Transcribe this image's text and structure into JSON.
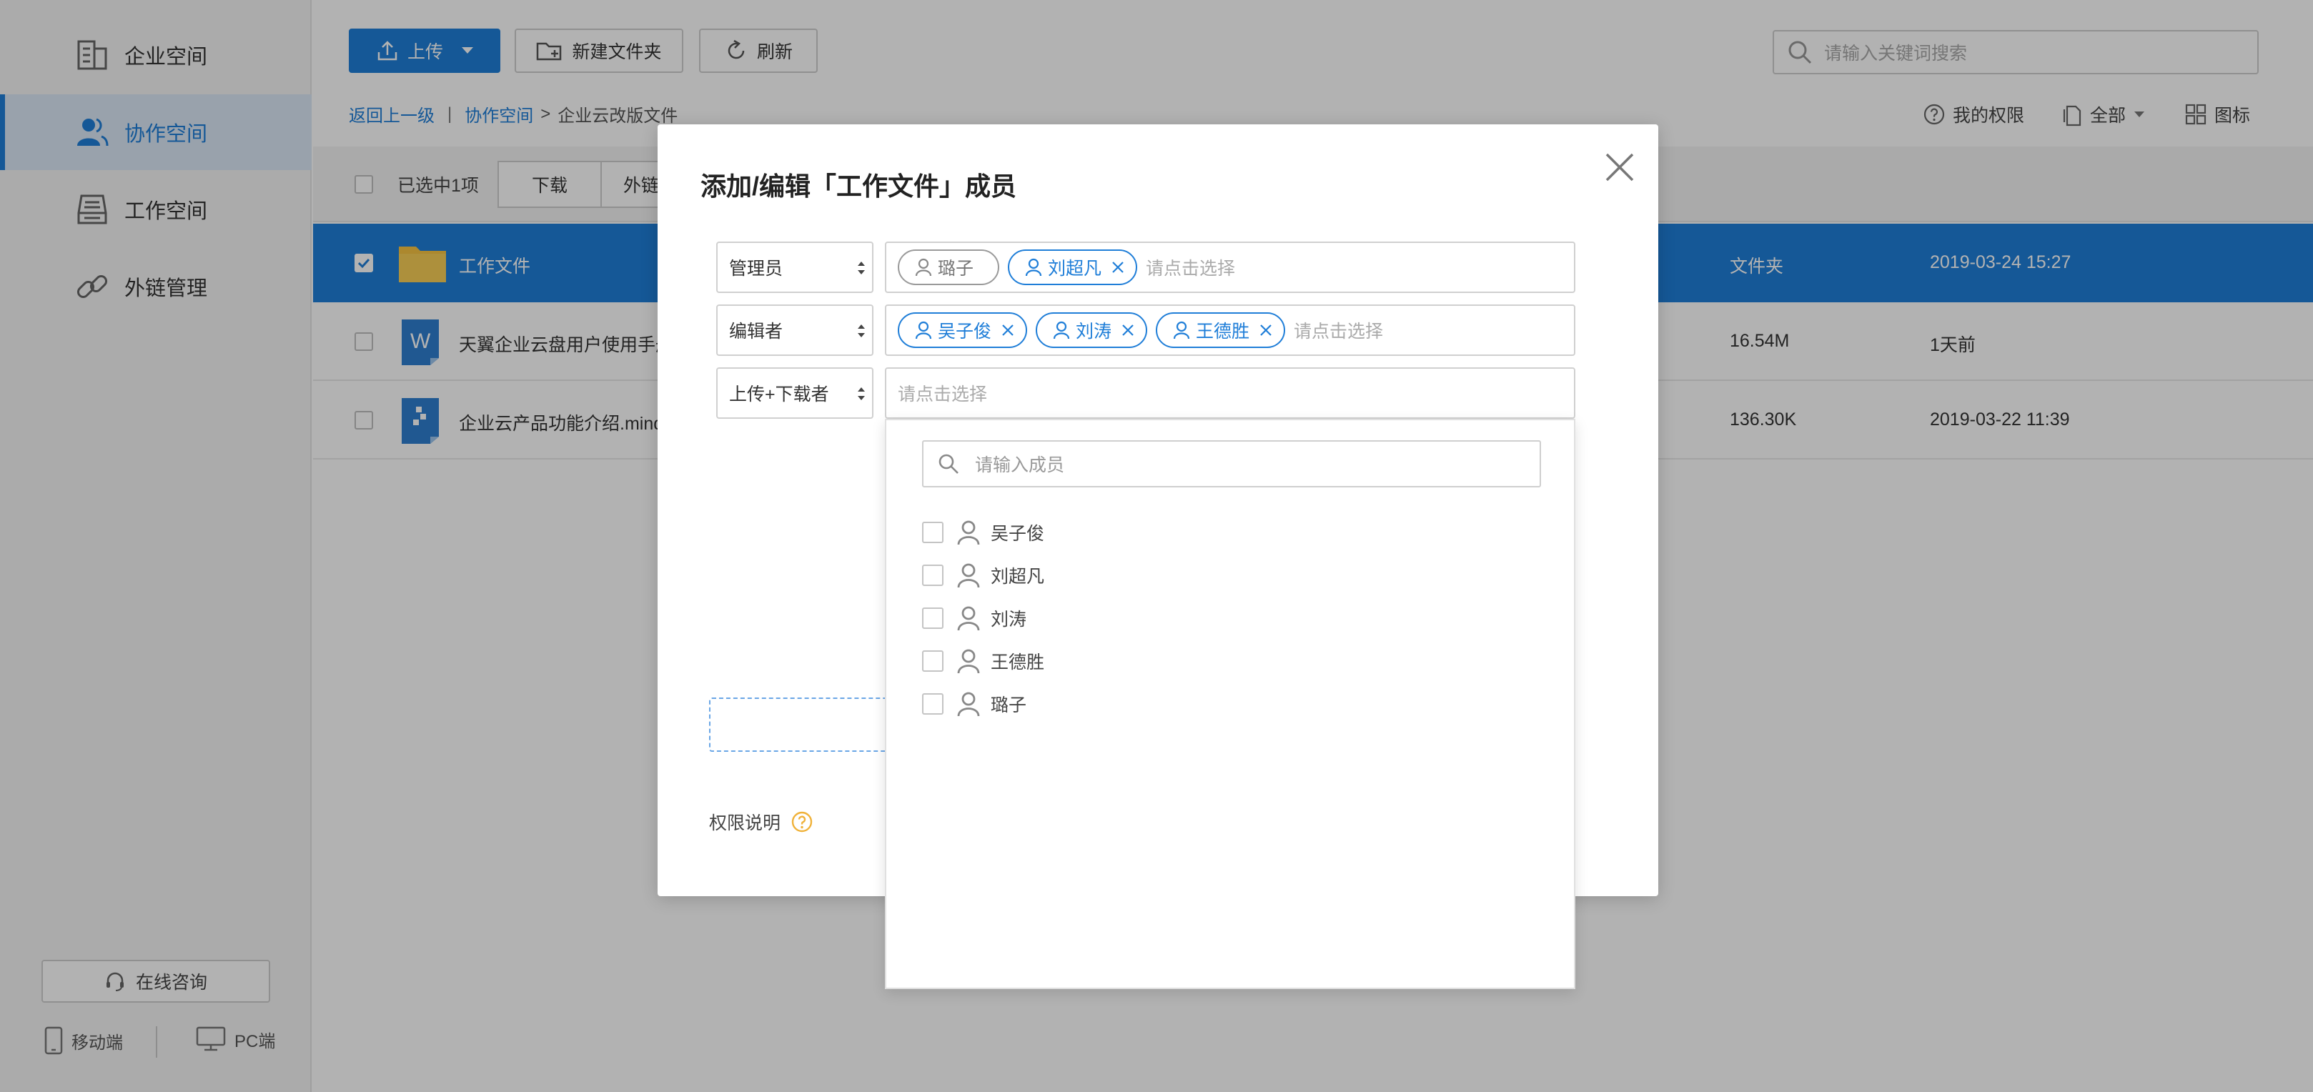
{
  "sidebar": {
    "items": [
      {
        "label": "企业空间",
        "icon": "building-icon"
      },
      {
        "label": "协作空间",
        "icon": "team-icon",
        "active": true
      },
      {
        "label": "工作空间",
        "icon": "inbox-icon"
      },
      {
        "label": "外链管理",
        "icon": "link-icon"
      }
    ],
    "consult_label": "在线咨询",
    "mobile_label": "移动端",
    "pc_label": "PC端"
  },
  "toolbar": {
    "upload_label": "上传",
    "new_folder_label": "新建文件夹",
    "refresh_label": "刷新",
    "search_placeholder": "请输入关键词搜索"
  },
  "breadcrumb": {
    "back": "返回上一级",
    "separator": "|",
    "parent": "协作空间",
    "arrow": ">",
    "current": "企业云改版文件"
  },
  "view_tools": {
    "permission": "我的权限",
    "filter": "全部",
    "view_mode": "图标"
  },
  "action_bar": {
    "selected_text": "已选中1项",
    "download": "下载",
    "share_link": "外链"
  },
  "files": [
    {
      "name": "工作文件",
      "type": "文件夹",
      "date": "2019-03-24 15:27",
      "selected": true,
      "icon": "folder-icon"
    },
    {
      "name": "天翼企业云盘用户使用手册",
      "type": "16.54M",
      "date": "1天前",
      "selected": false,
      "icon": "word-doc-icon",
      "icon_letter": "W"
    },
    {
      "name": "企业云产品功能介绍.mindr",
      "type": "136.30K",
      "date": "2019-03-22 11:39",
      "selected": false,
      "icon": "mindmap-file-icon"
    }
  ],
  "modal": {
    "title": "添加/编辑「工作文件」成员",
    "placeholder": "请点击选择",
    "roles": [
      {
        "role": "管理员",
        "members": [
          {
            "name": "璐子",
            "removable": false
          },
          {
            "name": "刘超凡",
            "removable": true
          }
        ]
      },
      {
        "role": "编辑者",
        "members": [
          {
            "name": "吴子俊",
            "removable": true
          },
          {
            "name": "刘涛",
            "removable": true
          },
          {
            "name": "王德胜",
            "removable": true
          }
        ]
      },
      {
        "role": "上传+下载者",
        "members": []
      }
    ],
    "permission_note": "权限说明"
  },
  "dropdown": {
    "search_placeholder": "请输入成员",
    "options": [
      "吴子俊",
      "刘超凡",
      "刘涛",
      "王德胜",
      "璐子"
    ]
  },
  "colors": {
    "accent": "#1f7ed8",
    "warning": "#f0b23a"
  }
}
